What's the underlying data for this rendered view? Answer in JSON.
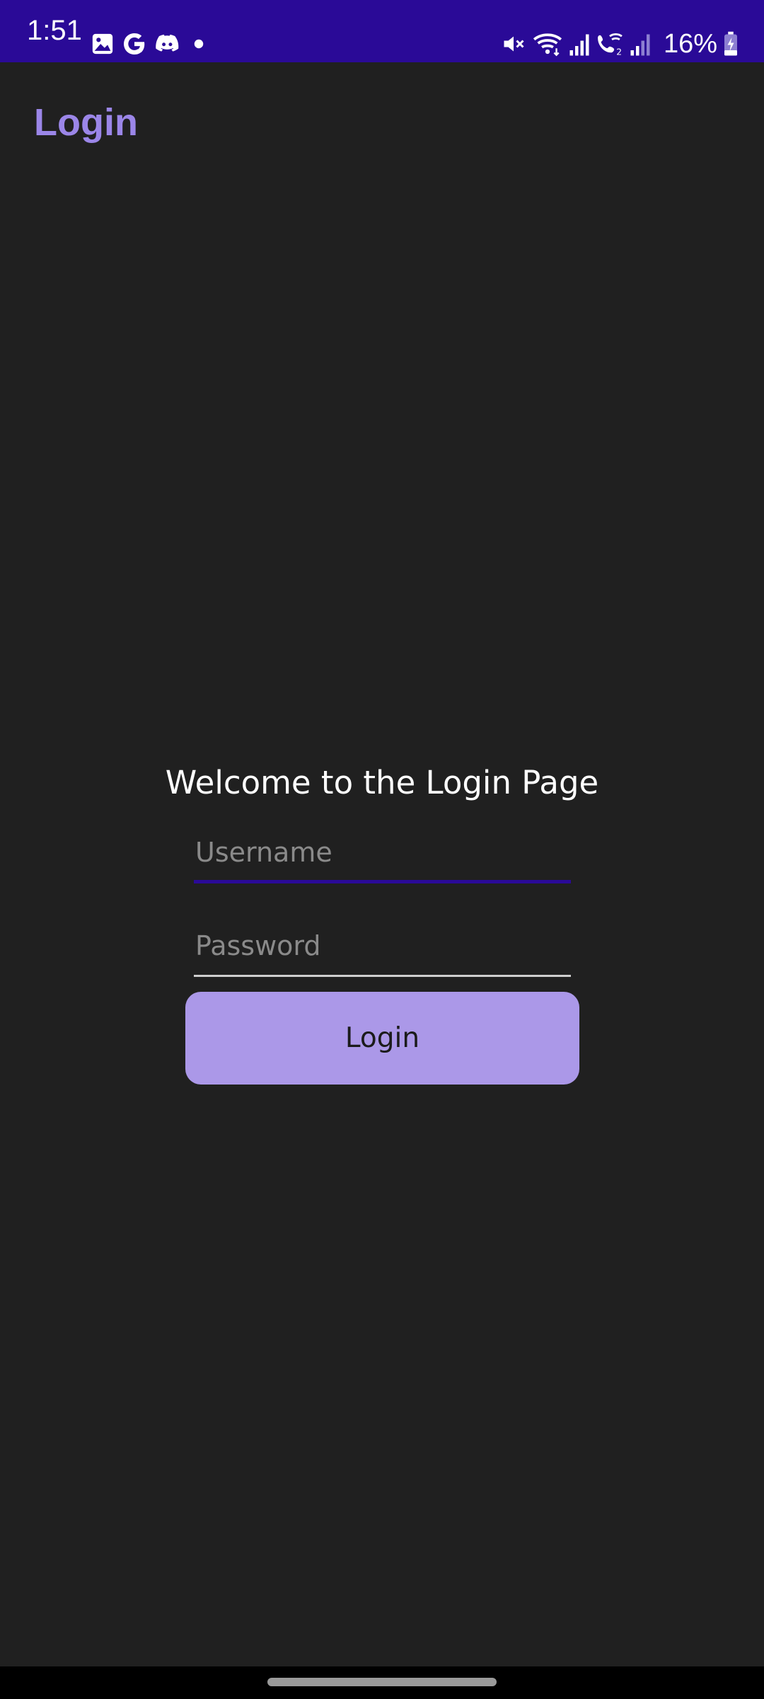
{
  "status_bar": {
    "time": "1:51",
    "battery_percent": "16%",
    "left_icons": [
      "gallery-icon",
      "google-icon",
      "discord-icon",
      "dot-icon"
    ],
    "right_icons": [
      "mute-icon",
      "wifi-icon",
      "signal-icon",
      "wifi-calling-icon",
      "signal-weak-icon",
      "battery-charging-icon"
    ],
    "background_color": "#2a0a97"
  },
  "app_bar": {
    "title": "Login",
    "title_color": "#9b86e8"
  },
  "login_form": {
    "welcome_text": "Welcome to the Login Page",
    "username": {
      "placeholder": "Username",
      "value": "",
      "focused": true
    },
    "password": {
      "placeholder": "Password",
      "value": ""
    },
    "login_button_label": "Login",
    "button_color": "#ab98e8"
  },
  "colors": {
    "background": "#202020",
    "accent": "#2a0a97"
  }
}
